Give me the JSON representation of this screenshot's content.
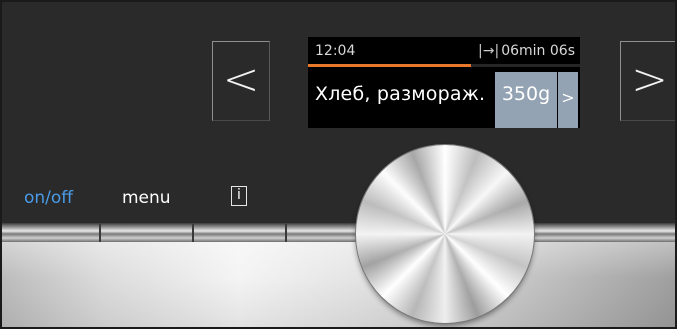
{
  "navigation": {
    "prev_glyph": "<",
    "next_glyph": ">"
  },
  "display": {
    "clock": "12:04",
    "timer_icon": "|→|",
    "timer": "06min 06s",
    "progress_fraction": 0.6,
    "program": "Хлеб, размораж.",
    "weight": "350g",
    "weight_next_glyph": ">",
    "accent_color": "#e8792a",
    "highlight_color": "#93a3b3"
  },
  "controls": {
    "on_off": "on/off",
    "menu": "menu",
    "info": "i",
    "on_off_color": "#4a9be6"
  }
}
